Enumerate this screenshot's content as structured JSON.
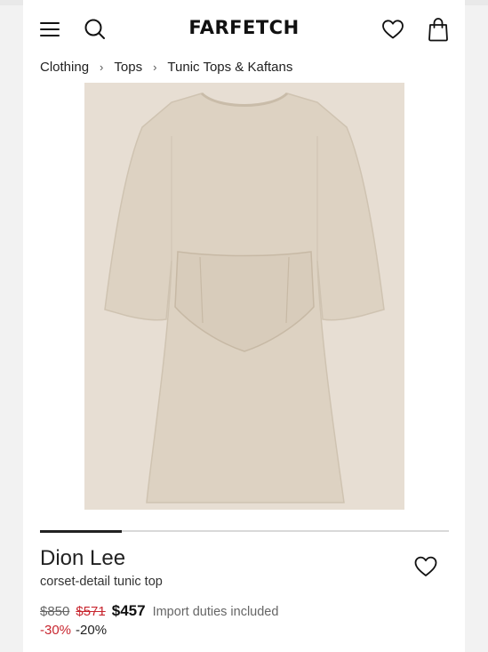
{
  "header": {
    "logo": "FARFETCH",
    "icons": [
      "menu-icon",
      "search-icon",
      "heart-icon",
      "bag-icon"
    ]
  },
  "breadcrumb": {
    "items": [
      "Clothing",
      "Tops",
      "Tunic Tops & Kaftans"
    ],
    "separator": "›"
  },
  "gallery": {
    "progress_fraction": 0.2
  },
  "product": {
    "brand": "Dion Lee",
    "description": "corset-detail tunic top",
    "price_original": "$850",
    "price_previous": "$571",
    "price_final": "$457",
    "duties_note": "Import duties included",
    "discount_first": "-30%",
    "discount_second": "-20%",
    "image_color": "#ddd2c2"
  },
  "colors": {
    "sale_red": "#c8262f",
    "text": "#222222"
  }
}
